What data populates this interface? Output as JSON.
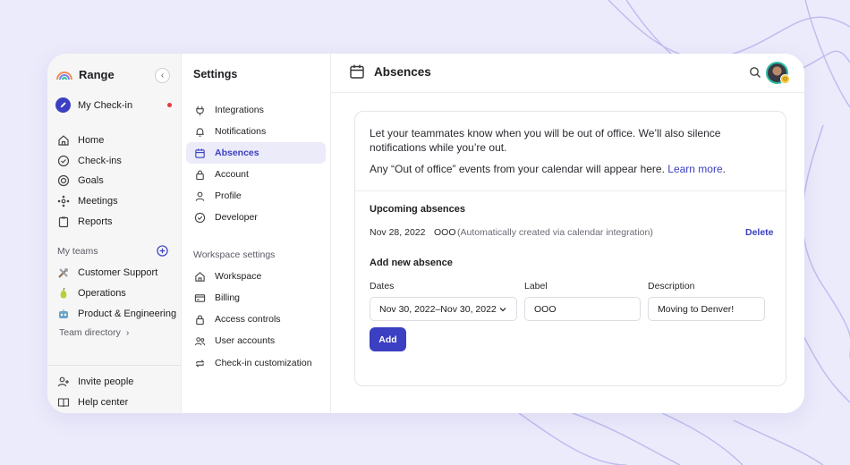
{
  "brand": {
    "name": "Range"
  },
  "nav": {
    "my_checkin": "My Check-in",
    "items": [
      {
        "label": "Home",
        "icon": "home-icon"
      },
      {
        "label": "Check-ins",
        "icon": "check-circle-icon"
      },
      {
        "label": "Goals",
        "icon": "target-icon"
      },
      {
        "label": "Meetings",
        "icon": "meetings-icon"
      },
      {
        "label": "Reports",
        "icon": "clipboard-icon"
      }
    ],
    "my_teams_label": "My teams",
    "teams": [
      {
        "label": "Customer Support",
        "icon": "tools-emoji-icon"
      },
      {
        "label": "Operations",
        "icon": "pear-emoji-icon"
      },
      {
        "label": "Product & Engineering",
        "icon": "robot-emoji-icon"
      }
    ],
    "team_directory": "Team directory",
    "footer": [
      {
        "label": "Invite people",
        "icon": "add-user-icon"
      },
      {
        "label": "Help center",
        "icon": "book-icon"
      }
    ]
  },
  "settings": {
    "title": "Settings",
    "items": [
      {
        "label": "Integrations",
        "icon": "plug-icon"
      },
      {
        "label": "Notifications",
        "icon": "bell-icon"
      },
      {
        "label": "Absences",
        "icon": "calendar-icon"
      },
      {
        "label": "Account",
        "icon": "lock-icon"
      },
      {
        "label": "Profile",
        "icon": "user-icon"
      },
      {
        "label": "Developer",
        "icon": "check-circle-icon"
      }
    ],
    "workspace_label": "Workspace settings",
    "workspace_items": [
      {
        "label": "Workspace",
        "icon": "home-icon"
      },
      {
        "label": "Billing",
        "icon": "card-icon"
      },
      {
        "label": "Access controls",
        "icon": "lock-icon"
      },
      {
        "label": "User accounts",
        "icon": "users-icon"
      },
      {
        "label": "Check-in customization",
        "icon": "repeat-icon"
      }
    ]
  },
  "main": {
    "title": "Absences",
    "intro_line1": "Let your teammates know when you will be out of office. We’ll also silence notifications while you’re out.",
    "intro_line2": "Any “Out of office” events from your calendar will appear here.",
    "learn_more": "Learn more",
    "upcoming_heading": "Upcoming absences",
    "absence": {
      "date": "Nov 28, 2022",
      "label": "OOO",
      "note": "(Automatically created via calendar integration)",
      "delete": "Delete"
    },
    "add_heading": "Add new absence",
    "form": {
      "dates_label": "Dates",
      "dates_value": "Nov 30, 2022–Nov 30, 2022",
      "label_label": "Label",
      "label_value": "OOO",
      "description_label": "Description",
      "description_value": "Moving to Denver!",
      "add_button": "Add"
    }
  },
  "colors": {
    "accent": "#3b3fc1",
    "background": "#ecebfb",
    "active_bg": "#ebebf9",
    "notification_dot": "#e5383b"
  }
}
